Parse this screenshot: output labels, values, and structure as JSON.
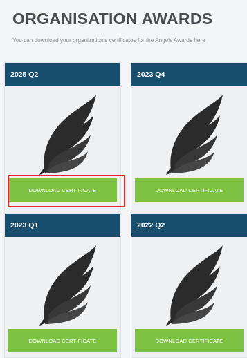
{
  "page": {
    "title": "ORGANISATION AWARDS",
    "subtitle": "You can download your organization's certificates for the Angels Awards here"
  },
  "cards": [
    {
      "period": "2025 Q2",
      "button_label": "DOWNLOAD CERTIFICATE",
      "highlighted": true
    },
    {
      "period": "2023 Q4",
      "button_label": "DOWNLOAD CERTIFICATE",
      "highlighted": false
    },
    {
      "period": "2023 Q1",
      "button_label": "DOWNLOAD CERTIFICATE",
      "highlighted": false
    },
    {
      "period": "2022 Q2",
      "button_label": "DOWNLOAD CERTIFICATE",
      "highlighted": false
    }
  ],
  "colors": {
    "header_bg": "#174e6e",
    "button_bg": "#7dc243",
    "highlight_border": "#e0262a",
    "wing": "#2b2b2b"
  },
  "icons": {
    "award_badge": "angel-wing-icon"
  }
}
